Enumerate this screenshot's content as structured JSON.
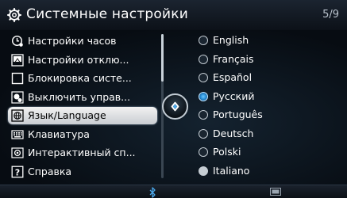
{
  "header": {
    "title": "Системные настройки",
    "page_counter": "5/9",
    "icon": "gear-icon"
  },
  "menu": {
    "items": [
      {
        "label": "Настройки часов",
        "icon": "clock-settings-icon"
      },
      {
        "label": "Настройки отклю...",
        "icon": "display-off-icon"
      },
      {
        "label": "Блокировка систе...",
        "icon": "checkbox-icon"
      },
      {
        "label": "Выключить управ...",
        "icon": "steering-control-icon"
      },
      {
        "label": "Язык/Language",
        "icon": "language-icon",
        "selected": true
      },
      {
        "label": "Клавиатура",
        "icon": "keyboard-icon"
      },
      {
        "label": "Интерактивный сп...",
        "icon": "interactive-guide-icon"
      },
      {
        "label": "Справка",
        "icon": "help-icon"
      }
    ]
  },
  "languages": {
    "items": [
      {
        "label": "English"
      },
      {
        "label": "Français"
      },
      {
        "label": "Español"
      },
      {
        "label": "Русский",
        "selected": true
      },
      {
        "label": "Português"
      },
      {
        "label": "Deutsch"
      },
      {
        "label": "Polski"
      },
      {
        "label": "Italiano"
      }
    ]
  },
  "footer": {
    "bluetooth_icon": "bluetooth-icon",
    "screen_icon": "screen-icon"
  },
  "colors": {
    "selection_accent": "#2a8fd8",
    "text": "#ffffff",
    "background": "#050a10"
  }
}
